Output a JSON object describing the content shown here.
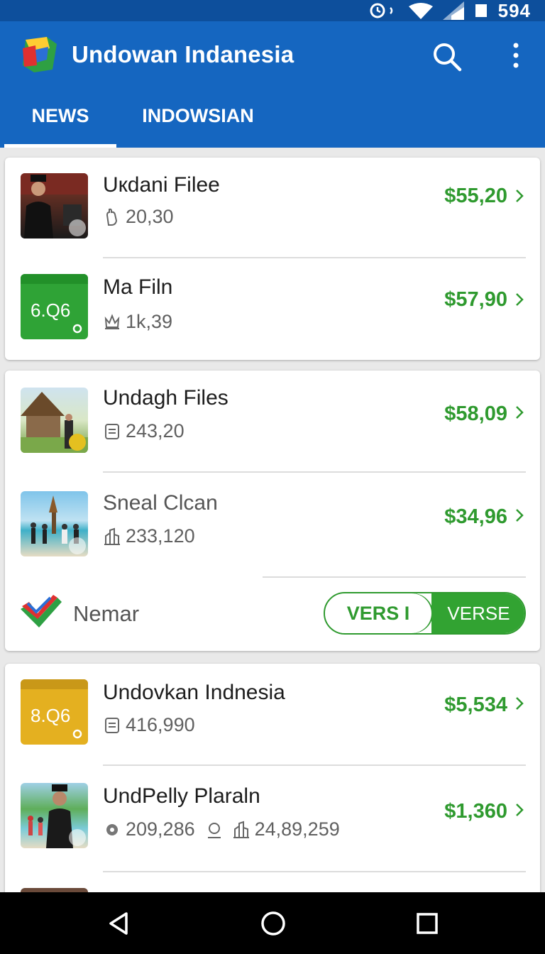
{
  "status_bar": {
    "battery_text": "594"
  },
  "app_bar": {
    "title": "Undowan Indanesia"
  },
  "tabs": [
    {
      "label": "NEWS",
      "active": true
    },
    {
      "label": "INDOWSIAN",
      "active": false
    }
  ],
  "items": [
    {
      "title": "Uкdani Filee",
      "meta": "20,30",
      "meta_icon": "hand-icon",
      "price": "$55,20",
      "thumb": "photo-man-ceremony"
    },
    {
      "title": "Ma Filn",
      "meta": "1k,39",
      "meta_icon": "crown-icon",
      "price": "$57,90",
      "thumb_text": "6.Q6",
      "thumb_color": "#2fa336"
    },
    {
      "title": "Undagh Files",
      "meta": "243,20",
      "meta_icon": "receipt-icon",
      "price": "$58,09",
      "thumb": "photo-traditional-house"
    },
    {
      "title": "Sneal Clcan",
      "meta": "233,120",
      "meta_icon": "building-icon",
      "price": "$34,96",
      "thumb": "photo-beach-group"
    },
    {
      "title": "Undovkan Indnesia",
      "meta": "416,990",
      "meta_icon": "receipt-icon",
      "price": "$5,534",
      "thumb_text": "8.Q6",
      "thumb_color": "#e4b020"
    },
    {
      "title": "UndPelly Plaraln",
      "meta": "209,286",
      "meta_icon": "gear-icon",
      "meta2": "24,89,259",
      "meta2_icon": "building-icon",
      "price": "$1,360",
      "thumb": "photo-man-beach"
    }
  ],
  "toggle_row": {
    "label": "Nemar",
    "left_option": "VERS I",
    "right_option": "VERSE"
  },
  "colors": {
    "app_bar": "#1566c0",
    "status_bar": "#0d4f9c",
    "price": "#2f9a2f"
  }
}
